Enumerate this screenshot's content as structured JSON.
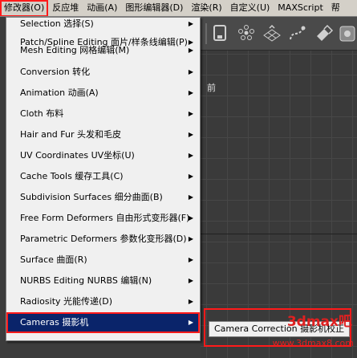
{
  "menubar": {
    "items": [
      {
        "label": "修改器(O)",
        "active": true
      },
      {
        "label": "反应堆"
      },
      {
        "label": "动画(A)"
      },
      {
        "label": "图形编辑器(D)"
      },
      {
        "label": "渲染(R)"
      },
      {
        "label": "自定义(U)"
      },
      {
        "label": "MAXScript"
      },
      {
        "label": "帮"
      }
    ]
  },
  "viewport": {
    "label": "前"
  },
  "menu": {
    "items": [
      {
        "label": "Selection 选择(S)"
      },
      {
        "label": "Patch/Spline Editing 面片/样条线编辑(P)"
      },
      {
        "label": "Mesh Editing 网格编辑(M)"
      },
      {
        "label": "Conversion 转化"
      },
      {
        "label": "Animation 动画(A)"
      },
      {
        "label": "Cloth 布料"
      },
      {
        "label": "Hair and Fur 头发和毛皮"
      },
      {
        "label": "UV Coordinates UV坐标(U)"
      },
      {
        "label": "Cache Tools 缓存工具(C)"
      },
      {
        "label": "Subdivision Surfaces 细分曲面(B)"
      },
      {
        "label": "Free Form Deformers 自由形式变形器(F)"
      },
      {
        "label": "Parametric Deformers 参数化变形器(D)"
      },
      {
        "label": "Surface 曲面(R)"
      },
      {
        "label": "NURBS Editing NURBS 编辑(N)"
      },
      {
        "label": "Radiosity 光能传递(D)"
      },
      {
        "label": "Cameras 摄影机",
        "selected": true
      }
    ],
    "arrow_glyph": "▶"
  },
  "submenu": {
    "items": [
      {
        "label": "Camera Correction 摄影机校正"
      }
    ]
  },
  "watermark": {
    "text": "3dmax吧",
    "subtext": "www.3dmax8.com"
  },
  "colors": {
    "highlight_outline": "#ff1a1a",
    "selected_bg": "#0a246a",
    "menu_bg": "#f0f0f0",
    "menubar_bg": "#d4d0c8"
  }
}
